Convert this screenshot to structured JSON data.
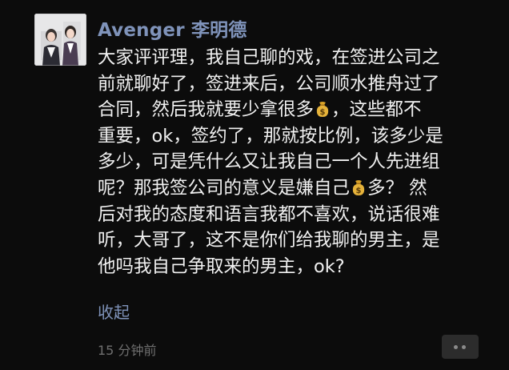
{
  "author": {
    "name": "Avenger 李明德"
  },
  "post": {
    "lines": [
      [
        "大家评评理，我自己聊的戏，在签进公司之"
      ],
      [
        "前就聊好了，签进来后，公司顺水推舟过了"
      ],
      [
        "合同，然后我就要少拿很多",
        "money-bag-emoji",
        "，这些都不"
      ],
      [
        "重要，ok，签约了，那就按比例，该多少是"
      ],
      [
        "多少，可是凭什么又让我自己一个人先进组"
      ],
      [
        "呢？那我签公司的意义是嫌自己",
        "money-bag-emoji",
        "多？ 然"
      ],
      [
        "后对我的态度和语言我都不喜欢，说话很难"
      ],
      [
        "听，大哥了，这不是你们给我聊的男主，是"
      ],
      [
        "他吗我自己争取来的男主，ok?"
      ]
    ]
  },
  "actions": {
    "collapse_label": "收起"
  },
  "meta": {
    "timestamp": "15 分钟前"
  },
  "colors": {
    "background": "#0c0c0c",
    "name_link": "#7f93ba",
    "body_text": "#f0f0f0",
    "timestamp": "#6f6f6f",
    "more_button_bg": "#2c2c2c"
  }
}
